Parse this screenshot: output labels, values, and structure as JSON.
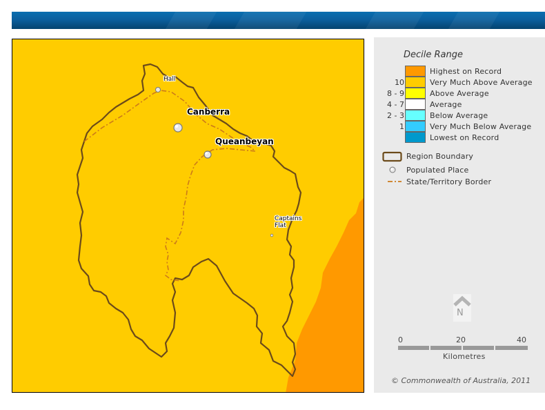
{
  "legend": {
    "title": "Decile Range",
    "deciles": [
      {
        "num": "",
        "label": "Highest on Record",
        "color": "#ff9900"
      },
      {
        "num": "10",
        "label": "Very Much Above Average",
        "color": "#ffcc00"
      },
      {
        "num": "8 - 9",
        "label": "Above Average",
        "color": "#ffff00"
      },
      {
        "num": "4 - 7",
        "label": "Average",
        "color": "#ffffff"
      },
      {
        "num": "2 - 3",
        "label": "Below Average",
        "color": "#66ffff"
      },
      {
        "num": "1",
        "label": "Very Much Below Average",
        "color": "#33ccff"
      },
      {
        "num": "",
        "label": "Lowest on Record",
        "color": "#0099cc"
      }
    ],
    "symbols": {
      "region_boundary": "Region Boundary",
      "populated_place": "Populated Place",
      "border": "State/Territory Border"
    },
    "north_label": "N",
    "scale": {
      "ticks": [
        "0",
        "20",
        "40"
      ],
      "unit": "Kilometres"
    },
    "copyright": "© Commonwealth of Australia, 2011"
  },
  "map": {
    "places": [
      {
        "name": "Hall",
        "line2": "",
        "size": "minor"
      },
      {
        "name": "Canberra",
        "line2": "",
        "size": "major"
      },
      {
        "name": "Queanbeyan",
        "line2": "",
        "size": "major"
      },
      {
        "name": "Captains",
        "line2": "Flat",
        "size": "minor"
      }
    ],
    "colors": {
      "background": "#ffcc00",
      "highest": "#ff9900",
      "boundary": "#6b4a1a",
      "border": "#cc7a1a"
    }
  }
}
